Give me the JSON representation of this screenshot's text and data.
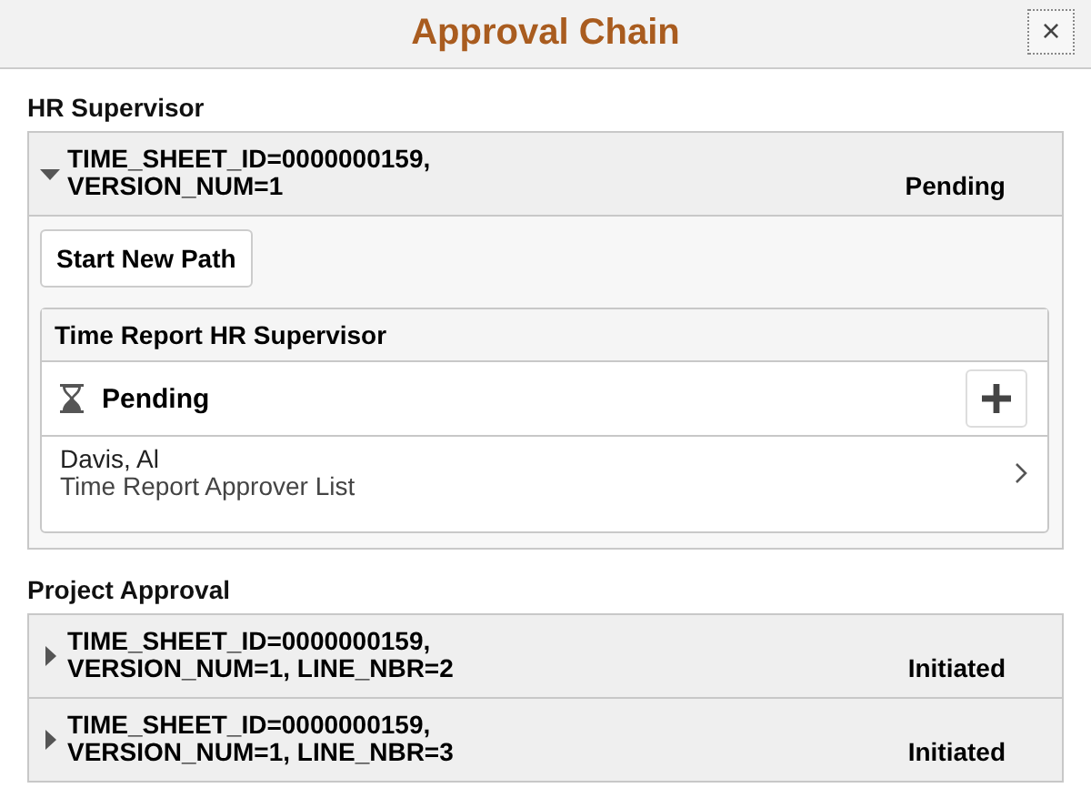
{
  "window": {
    "title": "Approval Chain",
    "close": "×"
  },
  "sections": [
    {
      "title": "HR Supervisor",
      "items": [
        {
          "lines": [
            "TIME_SHEET_ID=0000000159,",
            "VERSION_NUM=1"
          ],
          "status": "Pending",
          "expanded": true,
          "button": "Start New Path",
          "step": {
            "title": "Time Report HR Supervisor",
            "status": "Pending",
            "approver": "Davis, Al",
            "list": "Time Report Approver List"
          }
        }
      ]
    },
    {
      "title": "Project Approval",
      "items": [
        {
          "lines": [
            "TIME_SHEET_ID=0000000159,",
            "VERSION_NUM=1, LINE_NBR=2"
          ],
          "status": "Initiated",
          "expanded": false
        },
        {
          "lines": [
            "TIME_SHEET_ID=0000000159,",
            "VERSION_NUM=1, LINE_NBR=3"
          ],
          "status": "Initiated",
          "expanded": false
        }
      ]
    }
  ]
}
